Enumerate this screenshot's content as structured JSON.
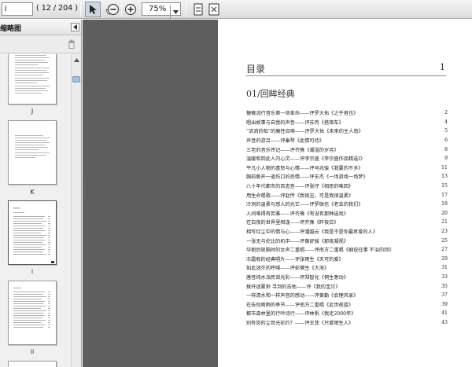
{
  "toolbar": {
    "page_value": "i",
    "page_count": "( 12 / 204 )",
    "zoom": "75%",
    "icons": [
      "select-arrow-icon",
      "hand-icon",
      "zoom-out-icon",
      "zoom-in-icon",
      "fit-width-icon",
      "fit-page-icon"
    ]
  },
  "sidebar": {
    "title": "缩略图",
    "thumbnails": [
      {
        "label": "J"
      },
      {
        "label": "K"
      },
      {
        "label": "i"
      },
      {
        "label": "ii"
      }
    ]
  },
  "document": {
    "toc_title": "目录",
    "toc_title_page": "1",
    "section_title": "01/回眸经典",
    "entries": [
      {
        "text": "梗概流行音乐第一场革命——评罗大佑《之乎者也》",
        "page": "2"
      },
      {
        "text": "唱出故事与自我的声音——评苏芮《搭错车》",
        "page": "4"
      },
      {
        "text": "“流浪的柏”的魔性召唤——评罗大佑《未来的主人翁》",
        "page": "5"
      },
      {
        "text": "声音的游吕——评秦琴《此情可待》",
        "page": "6"
      },
      {
        "text": "三宅的音乐传记——评齐豫《潮湿的岁月》",
        "page": "8"
      },
      {
        "text": "温暖和回此人内心灵——评李宗盛《李宗盛作品精选Ⅰ》",
        "page": "9"
      },
      {
        "text": "平凡小人物的喜怒与心情——评马兆骏《我要的不多》",
        "page": "11"
      },
      {
        "text": "胸前撕开一道伤口的悲情——评王杰《一场游戏一场梦》",
        "page": "13"
      },
      {
        "text": "八十年代都市的百态音——评张仔《相思的味回》",
        "page": "15"
      },
      {
        "text": "用生命唱歌——评赵传《我很丑，可是我很温柔》",
        "page": "17"
      },
      {
        "text": "冷冽的温柔与感人的光芒——评罗微信《老去的我们》",
        "page": "18"
      },
      {
        "text": "人间难得有若雅——评齐豫《有没有那种选戏》",
        "page": "20"
      },
      {
        "text": "在白夜的世界里相逢——评齐豫《昨夜日》",
        "page": "21"
      },
      {
        "text": "相写红尘中的情与心——评潘越云《我是不是你最疼爱的人》",
        "page": "23"
      },
      {
        "text": "一张无与伦比的机中——评黄舒骏《那夜凝视》",
        "page": "25"
      },
      {
        "text": "华丽后现脑时的女声二重唱——评南方二重唱《细说往事 不治的回》",
        "page": "27"
      },
      {
        "text": "冻霜般的经典唱片——评张雨生《天可的爱》",
        "page": "29"
      },
      {
        "text": "如此迷茫的呼喊——评彭蒨生《大海》",
        "page": "31"
      },
      {
        "text": "唐音纯水派民谣光彩——评郑智化《恫生意动》",
        "page": "33"
      },
      {
        "text": "拨开迷雾渺 寻到的吉他——评《我的宝贝》",
        "page": "35"
      },
      {
        "text": "一样清水和一样声音的感动——评黄勤《会理风录》",
        "page": "37"
      },
      {
        "text": "在告别雨雨的季节——评南方二重唱《此世夜蓝》",
        "page": "39"
      },
      {
        "text": "都市森林里的行吟诗行——评林帆《我走2000年》",
        "page": "41"
      },
      {
        "text": "别有岗的尘世光彩约？——评王菲《只爱陌生人》",
        "page": "43"
      }
    ]
  },
  "colors": {
    "workspace": "#5e5e5e",
    "toolbar": "#e6e6e6",
    "sidebar": "#f0f0f0"
  }
}
